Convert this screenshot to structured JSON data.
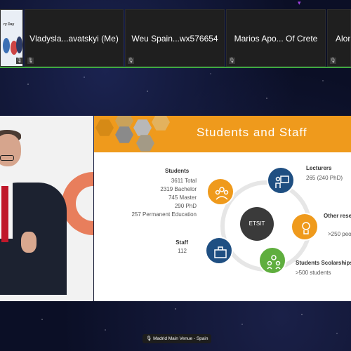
{
  "participants": [
    {
      "name": "",
      "thumb_label": "ry Day"
    },
    {
      "name": "Vladysla...avatskyi (Me)"
    },
    {
      "name": "Weu Spain...wx576654"
    },
    {
      "name": "Marios Apo... Of Crete"
    },
    {
      "name": "Alon"
    }
  ],
  "slide": {
    "title": "Students and Staff",
    "center_label": "ETSIT",
    "students": {
      "title": "Students",
      "lines": [
        "3611 Total",
        "2319 Bachelor",
        "745 Master",
        "290 PhD",
        "257 Permanent Education"
      ]
    },
    "staff": {
      "title": "Staff",
      "value": "112"
    },
    "lecturers": {
      "title": "Lecturers",
      "value": "265 (240 PhD)"
    },
    "other": {
      "title": "Other rese",
      "value": ">250 peo"
    },
    "scholarships": {
      "title": "Students Scolarships",
      "value": ">500 students"
    }
  },
  "venue_label": "Madrid Main Venue - Spain",
  "colors": {
    "accent_orange": "#ef9a1c",
    "node_blue": "#1f4f82",
    "node_green": "#5fae3e",
    "active_speaker": "#3fa83f"
  }
}
